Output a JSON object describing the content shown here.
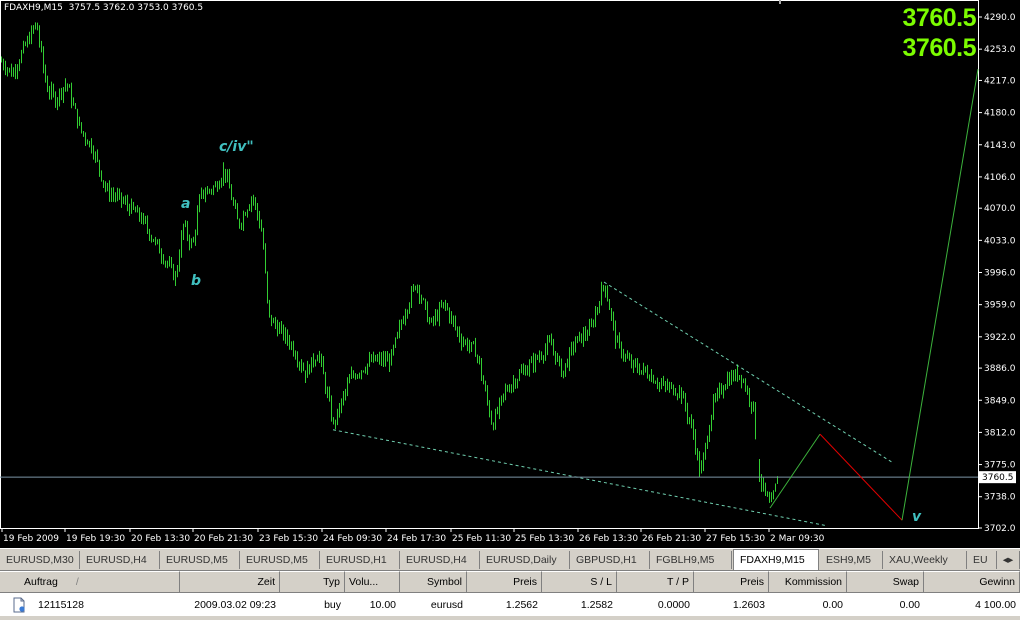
{
  "chart": {
    "symbol_info": "FDAXH9,M15  3757.5 3762.0 3753.0 3760.5",
    "bid": "3760.5",
    "ask": "3760.5",
    "current_price_label": "3760.5",
    "price_axis": [
      "4290.0",
      "4253.0",
      "4217.0",
      "4180.0",
      "4143.0",
      "4106.0",
      "4070.0",
      "4033.0",
      "3996.0",
      "3959.0",
      "3922.0",
      "3886.0",
      "3849.0",
      "3812.0",
      "3775.0",
      "3738.0",
      "3702.0"
    ],
    "time_axis": [
      "19 Feb 2009",
      "19 Feb 19:30",
      "20 Feb 13:30",
      "20 Feb 21:30",
      "23 Feb 15:30",
      "24 Feb 09:30",
      "24 Feb 17:30",
      "25 Feb 11:30",
      "25 Feb 13:30",
      "26 Feb 13:30",
      "26 Feb 21:30",
      "27 Feb 15:30",
      "2 Mar 09:30"
    ],
    "annotations": {
      "a": "a",
      "b": "b",
      "c": "c/iv\"",
      "v": "v"
    },
    "colors": {
      "background": "#000000",
      "candles": "#32cd32",
      "wave_label": "#40c0c0",
      "projection_up": "#3cb33c",
      "projection_down": "#e00000",
      "channel_upper": "#70d0b0",
      "channel_lower": "#70d0b0",
      "price_line": "#7c95a6"
    }
  },
  "tabs": [
    "EURUSD,M30",
    "EURUSD,H4",
    "EURUSD,M5",
    "EURUSD,M5",
    "EURUSD,H1",
    "EURUSD,H4",
    "EURUSD,Daily",
    "GBPUSD,H1",
    "FGBLH9,M5",
    "FDAXH9,M15",
    "ESH9,M5",
    "XAU,Weekly",
    "EU"
  ],
  "active_tab": "FDAXH9,M15",
  "terminal": {
    "headers": [
      "Auftrag",
      "/",
      "Zeit",
      "Typ",
      "Volu...",
      "Symbol",
      "Preis",
      "S / L",
      "T / P",
      "Preis",
      "Kommission",
      "Swap",
      "Gewinn"
    ],
    "rows": [
      {
        "order": "12115128",
        "time": "2009.03.02 09:23",
        "type": "buy",
        "volume": "10.00",
        "symbol": "eurusd",
        "open_price": "1.2562",
        "sl": "1.2582",
        "tp": "0.0000",
        "price": "1.2603",
        "commission": "0.00",
        "swap": "0.00",
        "profit": "4 100.00"
      }
    ]
  }
}
